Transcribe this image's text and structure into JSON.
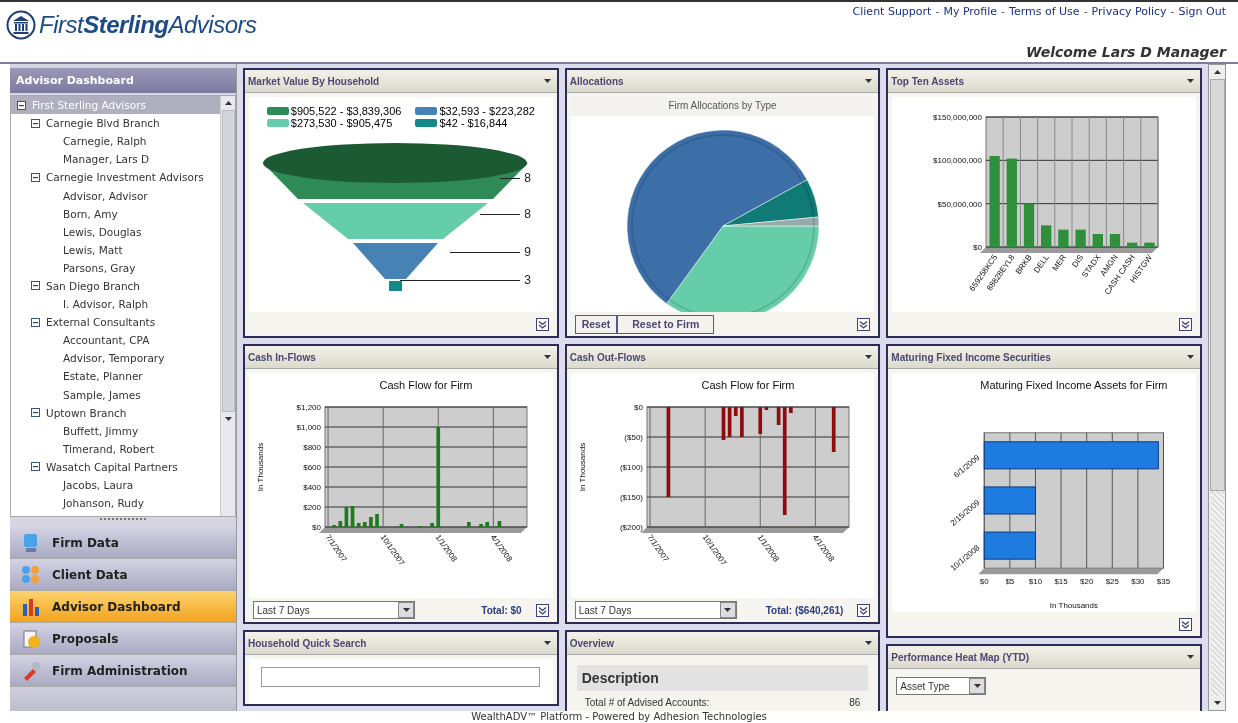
{
  "header": {
    "logo": "First**Sterling**Advisors",
    "links": [
      "Client Support",
      "My Profile",
      "Terms of Use",
      "Privacy Policy",
      "Sign Out"
    ],
    "separator": "-",
    "welcome": "Welcome Lars D Manager"
  },
  "sidebar": {
    "title": "Advisor Dashboard",
    "tree": [
      {
        "label": "First Sterling Advisors",
        "selected": true,
        "expanded": true,
        "children": [
          {
            "label": "Carnegie Blvd Branch",
            "selected": false,
            "expanded": true,
            "children": [
              {
                "label": "Carnegie, Ralph",
                "selected": false
              },
              {
                "label": "Manager, Lars D",
                "selected": false
              }
            ]
          },
          {
            "label": "Carnegie Investment Advisors",
            "selected": false,
            "expanded": true,
            "children": [
              {
                "label": "Advisor, Advisor",
                "selected": false
              },
              {
                "label": "Born, Amy",
                "selected": false
              },
              {
                "label": "Lewis, Douglas",
                "selected": false
              },
              {
                "label": "Lewis, Matt",
                "selected": false
              },
              {
                "label": "Parsons, Gray",
                "selected": false
              }
            ]
          },
          {
            "label": "San Diego Branch",
            "selected": false,
            "expanded": true,
            "children": [
              {
                "label": "I. Advisor, Ralph",
                "selected": false
              }
            ]
          },
          {
            "label": "External Consultants",
            "selected": false,
            "expanded": true,
            "children": [
              {
                "label": "Accountant, CPA",
                "selected": false
              },
              {
                "label": "Advisor, Temporary",
                "selected": false
              },
              {
                "label": "Estate, Planner",
                "selected": false
              },
              {
                "label": "Sample, James",
                "selected": false
              }
            ]
          },
          {
            "label": "Uptown Branch",
            "selected": false,
            "expanded": true,
            "children": [
              {
                "label": "Buffett, Jimmy",
                "selected": false
              },
              {
                "label": "Timerand, Robert",
                "selected": false
              }
            ]
          },
          {
            "label": "Wasatch Capital Partners",
            "selected": false,
            "expanded": true,
            "children": [
              {
                "label": "Jacobs, Laura",
                "selected": false
              },
              {
                "label": "Johanson, Rudy",
                "selected": false
              }
            ]
          }
        ]
      }
    ],
    "nav": [
      {
        "label": "Firm Data",
        "kind": "monitor",
        "selected": false
      },
      {
        "label": "Client Data",
        "kind": "people",
        "selected": false
      },
      {
        "label": "Advisor Dashboard",
        "kind": "chart",
        "selected": true
      },
      {
        "label": "Proposals",
        "kind": "document",
        "selected": false
      },
      {
        "label": "Firm Administration",
        "kind": "tool",
        "selected": false
      }
    ]
  },
  "columns": [
    {
      "panels": [
        {
          "kind": "funnel",
          "title": "Market Value By Household",
          "legend": [
            {
              "label": "$905,522 - $3,839,306",
              "color": "#2e8b57"
            },
            {
              "label": "$32,593 - $223,282",
              "color": "#4682b4"
            },
            {
              "label": "$273,530 - $905,475",
              "color": "#66cdaa"
            },
            {
              "label": "$42 - $16,844",
              "color": "#138a88"
            }
          ],
          "labels": [
            "8",
            "8",
            "9",
            "3"
          ]
        },
        {
          "kind": "chart",
          "title": "Cash In-Flows",
          "select": "Last 7 Days",
          "total": "Total: $0",
          "chart_data": {
            "type": "bar",
            "title": "Cash Flow for Firm",
            "ylabel": "In Thousands",
            "grid": true,
            "categories": [
              "7/1/2007",
              null,
              null,
              null,
              null,
              null,
              null,
              null,
              null,
              "10/1/2007",
              null,
              null,
              null,
              null,
              null,
              null,
              null,
              null,
              "1/1/2008",
              null,
              null,
              null,
              null,
              null,
              null,
              null,
              null,
              "4/1/2008",
              null,
              null,
              null,
              null,
              null
            ],
            "ylim": [
              0,
              1200
            ],
            "yticks": [
              {
                "value": 0,
                "label": "$0"
              },
              {
                "value": 200,
                "label": "$200"
              },
              {
                "value": 400,
                "label": "$400"
              },
              {
                "value": 600,
                "label": "$600"
              },
              {
                "value": 800,
                "label": "$800"
              },
              {
                "value": 1000,
                "label": "$1,000"
              },
              {
                "value": 1200,
                "label": "$1,200"
              }
            ],
            "series": [
              {
                "color": "#1e7a1e",
                "values": [
                  null,
                  20,
                  60,
                  200,
                  210,
                  40,
                  50,
                  100,
                  130,
                  null,
                  null,
                  null,
                  30,
                  null,
                  null,
                  10,
                  null,
                  40,
                  1000,
                  null,
                  null,
                  null,
                  null,
                  50,
                  null,
                  30,
                  50,
                  null,
                  60,
                  null,
                  null,
                  null,
                  null
                ]
              }
            ]
          }
        },
        {
          "kind": "search",
          "title": "Household Quick Search"
        },
        {
          "kind": "empty"
        }
      ]
    },
    {
      "panels": [
        {
          "kind": "pie",
          "title": "Allocations",
          "subtitle": "Firm Allocations by Type",
          "buttons": [
            "Reset",
            "Reset to Firm"
          ]
        },
        {
          "kind": "chart",
          "title": "Cash Out-Flows",
          "select": "Last 7 Days",
          "total": "Total: ($640,261)",
          "chart_data": {
            "type": "bar",
            "title": "Cash Flow for Firm",
            "ylabel": "In Thousands",
            "grid": true,
            "categories": [
              "7/1/2007",
              null,
              null,
              null,
              null,
              null,
              null,
              null,
              null,
              "10/1/2007",
              null,
              null,
              null,
              null,
              null,
              null,
              null,
              null,
              "1/1/2008",
              null,
              null,
              null,
              null,
              null,
              null,
              null,
              null,
              "4/1/2008",
              null,
              null,
              null,
              null,
              null
            ],
            "ylim": [
              -200,
              0
            ],
            "yticks": [
              {
                "value": -200,
                "label": "($200)"
              },
              {
                "value": -150,
                "label": "($150)"
              },
              {
                "value": -100,
                "label": "($100)"
              },
              {
                "value": -50,
                "label": "($50)"
              },
              {
                "value": 0,
                "label": "$0"
              }
            ],
            "series": [
              {
                "color": "#8b0d0d",
                "values": [
                  null,
                  null,
                  null,
                  -150,
                  null,
                  null,
                  null,
                  null,
                  null,
                  null,
                  null,
                  null,
                  -55,
                  -50,
                  -15,
                  -50,
                  null,
                  null,
                  -45,
                  -5,
                  null,
                  -30,
                  -180,
                  -10,
                  null,
                  null,
                  null,
                  null,
                  null,
                  null,
                  -75,
                  null,
                  null
                ]
              }
            ]
          }
        },
        {
          "kind": "overview",
          "title": "Overview",
          "heading": "Description",
          "rows": [
            {
              "label": "Total # of Advised Accounts:",
              "value": "86"
            }
          ]
        }
      ]
    },
    {
      "panels": [
        {
          "kind": "chart",
          "title": "Top Ten Assets",
          "chart_data": {
            "type": "bar",
            "grid": true,
            "categories": [
              "659258KC5",
              "88828EYL8",
              "BRKB",
              "DELL",
              "MER",
              "DIS",
              "STADX",
              "AMGN",
              "CASH CASH",
              "HISTGW"
            ],
            "ylim": [
              0,
              150000000
            ],
            "yticks": [
              {
                "value": 0,
                "label": "$0"
              },
              {
                "value": 50000000,
                "label": "$50,000,000"
              },
              {
                "value": 100000000,
                "label": "$100,000,000"
              },
              {
                "value": 150000000,
                "label": "$150,000,000"
              }
            ],
            "series": [
              {
                "color": "#2f8f3a",
                "values": [
                  105000000,
                  102000000,
                  50000000,
                  25000000,
                  20000000,
                  20000000,
                  15000000,
                  15000000,
                  5000000,
                  5000000
                ]
              }
            ]
          }
        },
        {
          "kind": "chart",
          "title": "Maturing Fixed Income Securities",
          "chart_data": {
            "type": "bar",
            "orientation": "horizontal",
            "grid": true,
            "title": "Maturing Fixed Income Assets for Firm",
            "xlabel": "In Thousands",
            "categories": [
              "6/1/2009",
              "2/15/2009",
              "10/1/2008"
            ],
            "xlim": [
              0,
              35
            ],
            "xticks": [
              {
                "value": 0,
                "label": "$0"
              },
              {
                "value": 5,
                "label": "$5"
              },
              {
                "value": 10,
                "label": "$10"
              },
              {
                "value": 15,
                "label": "$15"
              },
              {
                "value": 20,
                "label": "$20"
              },
              {
                "value": 25,
                "label": "$25"
              },
              {
                "value": 30,
                "label": "$30"
              },
              {
                "value": 35,
                "label": "$35"
              }
            ],
            "series": [
              {
                "color": "#1e7be0",
                "values": [
                  34,
                  10,
                  10
                ]
              }
            ]
          }
        },
        {
          "kind": "heatmap",
          "title": "Performance Heat Map (YTD)",
          "select": "Asset Type"
        }
      ]
    }
  ],
  "footer": "WealthADV™ Platform - Powered by Adhesion Technologies"
}
